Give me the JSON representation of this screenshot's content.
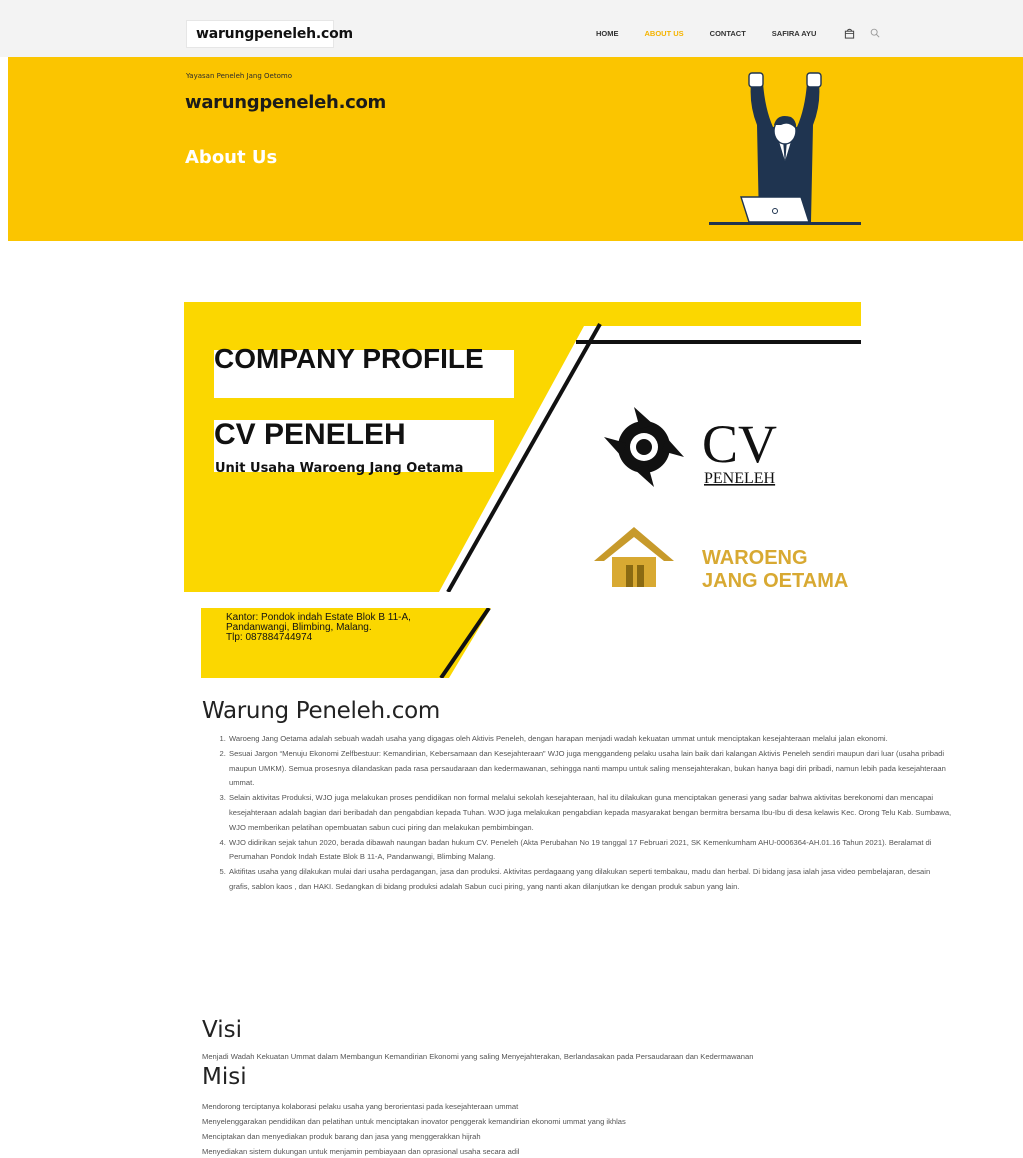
{
  "nav": {
    "logo": "warungpeneleh.com",
    "items": [
      {
        "label": "HOME",
        "active": false
      },
      {
        "label": "ABOUT US",
        "active": true
      },
      {
        "label": "CONTACT",
        "active": false
      },
      {
        "label": "SAFIRA AYU",
        "active": false
      }
    ],
    "icons": [
      "bag-icon",
      "search-icon"
    ]
  },
  "hero": {
    "subtitle": "Yayasan Peneleh Jang Oetomo",
    "site_title": "warungpeneleh.com",
    "page_title": "About Us",
    "bg_color": "#fbc500"
  },
  "banner": {
    "heading1": "COMPANY PROFILE",
    "heading2": "CV PENELEH",
    "tagline": "Unit Usaha Waroeng Jang Oetama",
    "logo_cv": "CV",
    "logo_cv_sub": "PENELEH",
    "logo_wjo_line1": "WAROENG",
    "logo_wjo_line2": "JANG OETAMA",
    "office_line1": "Kantor: Pondok indah Estate Blok B 11-A,",
    "office_line2": "Pandanwangi, Blimbing, Malang.",
    "office_line3": "Tlp: 087884744974"
  },
  "about": {
    "title": "Warung Peneleh.com",
    "points": [
      "Waroeng Jang Oetama adalah sebuah wadah usaha yang digagas oleh Aktivis Peneleh, dengan harapan menjadi wadah kekuatan ummat untuk menciptakan kesejahteraan melalui jalan ekonomi.",
      "Sesuai Jargon “Menuju Ekonomi Zelfbestuur: Kemandirian, Kebersamaan dan Kesejahteraan” WJO juga menggandeng pelaku usaha lain baik dari kalangan Aktivis Peneleh sendiri maupun dari luar (usaha pribadi maupun UMKM). Semua prosesnya dilandaskan pada rasa persaudaraan dan kedermawanan, sehingga nanti mampu untuk saling mensejahterakan, bukan hanya bagi diri pribadi, namun lebih pada kesejahteraan ummat.",
      "Selain aktivitas Produksi, WJO juga melakukan proses pendidikan non formal melalui sekolah kesejahteraan, hal itu dilakukan guna menciptakan generasi yang sadar bahwa aktivitas berekonomi dan mencapai kesejahteraan adalah bagian dari beribadah dan pengabdian kepada Tuhan. WJO juga melakukan pengabdian kepada masyarakat bengan bermitra bersama Ibu-Ibu di desa kelawis Kec. Orong Telu Kab. Sumbawa, WJO memberikan pelatihan opembuatan sabun cuci piring dan melakukan pembimbingan.",
      "WJO didirikan sejak tahun 2020, berada dibawah naungan badan hukum CV. Peneleh (Akta Perubahan No 19 tanggal 17 Februari 2021, SK Kemenkumham AHU-0006364-AH.01.16 Tahun 2021). Beralamat di Perumahan Pondok Indah Estate Blok B 11-A, Pandanwangi, Blimbing Malang.",
      "Aktifitas usaha yang dilakukan mulai dari usaha perdagangan, jasa dan produksi. Aktivitas perdagaang yang dilakukan seperti tembakau, madu dan herbal. Di bidang jasa ialah jasa video pembelajaran, desain grafis, sablon kaos , dan HAKI. Sedangkan di bidang produksi adalah Sabun cuci piring, yang nanti akan dilanjutkan ke dengan produk sabun yang lain."
    ]
  },
  "visi": {
    "title": "Visi",
    "text": "Menjadi Wadah Kekuatan Ummat dalam Membangun Kemandirian Ekonomi yang saling Menyejahterakan, Berlandasakan pada Persaudaraan dan Kedermawanan"
  },
  "misi": {
    "title": "Misi",
    "items": [
      "Mendorong terciptanya kolaborasi pelaku usaha yang berorientasi pada kesejahteraan ummat",
      "Menyelenggarakan pendidikan dan pelatihan untuk menciptakan inovator penggerak kemandirian ekonomi ummat yang ikhlas",
      "Menciptakan dan menyediakan produk barang dan jasa yang menggerakkan hijrah",
      "Menyediakan sistem dukungan untuk menjamin pembiayaan dan oprasional usaha secara adil"
    ]
  }
}
